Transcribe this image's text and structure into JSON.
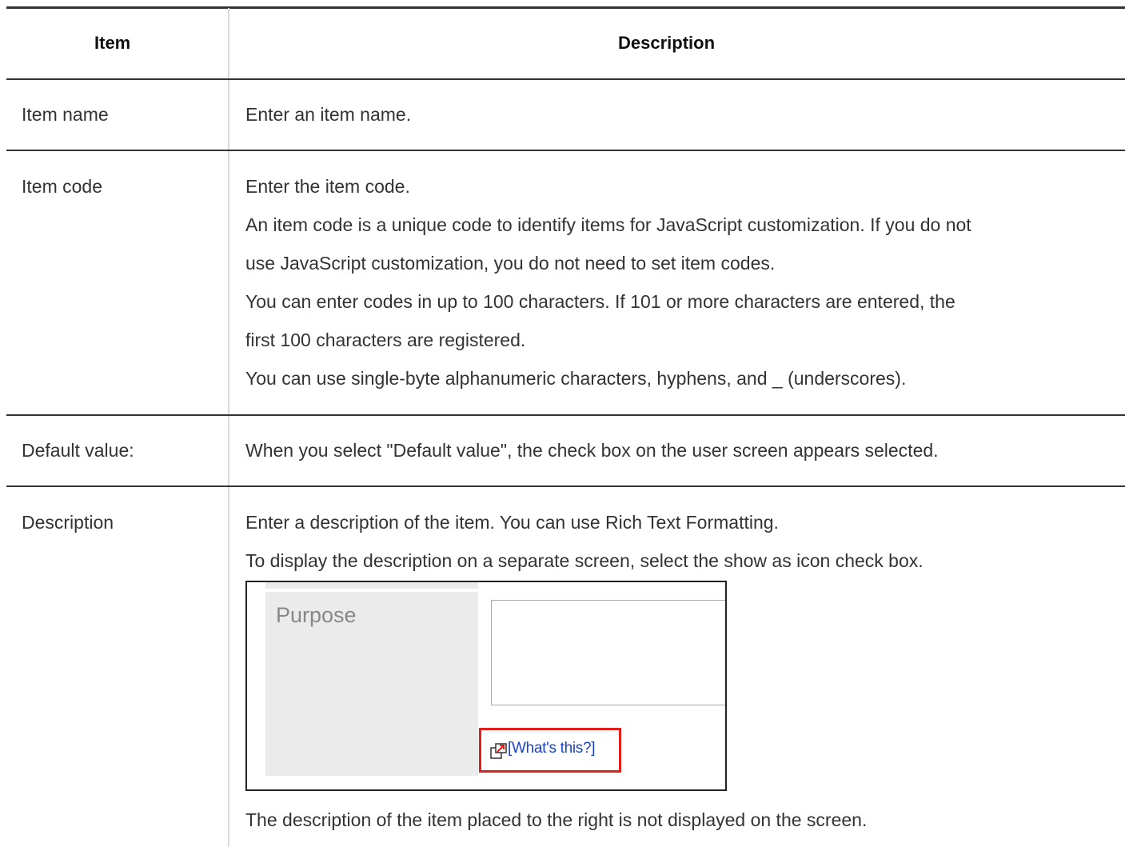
{
  "header": {
    "item": "Item",
    "description": "Description"
  },
  "rows": [
    {
      "label": "Item name",
      "description": [
        "Enter an item name."
      ]
    },
    {
      "label": "Item code",
      "description": [
        "Enter the item code.",
        "An item code is a unique code to identify items for JavaScript customization. If you do not",
        "use JavaScript customization, you do not need to set item codes.",
        "You can enter codes in up to 100 characters. If 101 or more characters are entered, the",
        "first 100 characters are registered.",
        "You can use single-byte alphanumeric characters, hyphens, and _ (underscores)."
      ]
    },
    {
      "label": "Default value:",
      "description": [
        "When you select \"Default value\", the check box on the user screen appears selected."
      ]
    },
    {
      "label": "Description",
      "description": [
        "Enter a description of the item. You can use Rich Text Formatting.",
        "To display the description on a separate screen, select the show as icon check box."
      ],
      "note": "The description of the item placed to the right is not displayed on the screen."
    }
  ],
  "example_screenshot": {
    "field_label": "Purpose",
    "link_text": "[What's this?]",
    "link_icon": "open-in-new-window-icon",
    "highlight_color": "#e0211b",
    "link_color": "#1b45c9"
  }
}
